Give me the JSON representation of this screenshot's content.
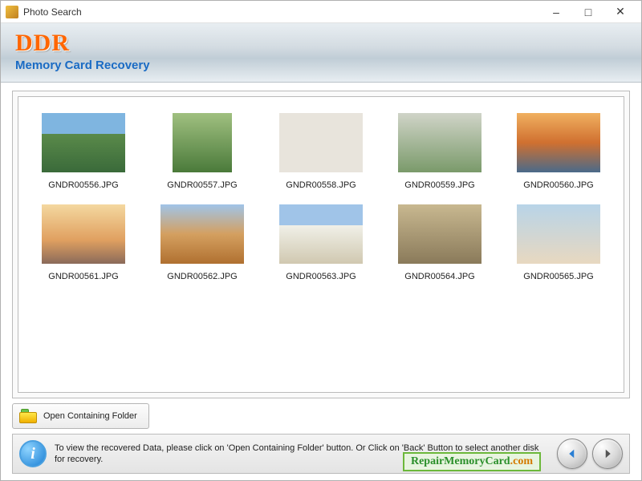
{
  "window": {
    "title": "Photo Search"
  },
  "header": {
    "brand": "DDR",
    "subtitle": "Memory Card Recovery"
  },
  "thumbnails": [
    {
      "filename": "GNDR00556.JPG",
      "css": "t556"
    },
    {
      "filename": "GNDR00557.JPG",
      "css": "t557"
    },
    {
      "filename": "GNDR00558.JPG",
      "css": "t558"
    },
    {
      "filename": "GNDR00559.JPG",
      "css": "t559"
    },
    {
      "filename": "GNDR00560.JPG",
      "css": "t560"
    },
    {
      "filename": "GNDR00561.JPG",
      "css": "t561"
    },
    {
      "filename": "GNDR00562.JPG",
      "css": "t562"
    },
    {
      "filename": "GNDR00563.JPG",
      "css": "t563"
    },
    {
      "filename": "GNDR00564.JPG",
      "css": "t564"
    },
    {
      "filename": "GNDR00565.JPG",
      "css": "t565"
    }
  ],
  "actions": {
    "open_folder_label": "Open Containing Folder"
  },
  "footer": {
    "info_text": "To view the recovered Data, please click on 'Open Containing Folder' button. Or Click on 'Back' Button to select another disk for recovery.",
    "watermark_main": "RepairMemoryCard",
    "watermark_tld": ".com"
  }
}
